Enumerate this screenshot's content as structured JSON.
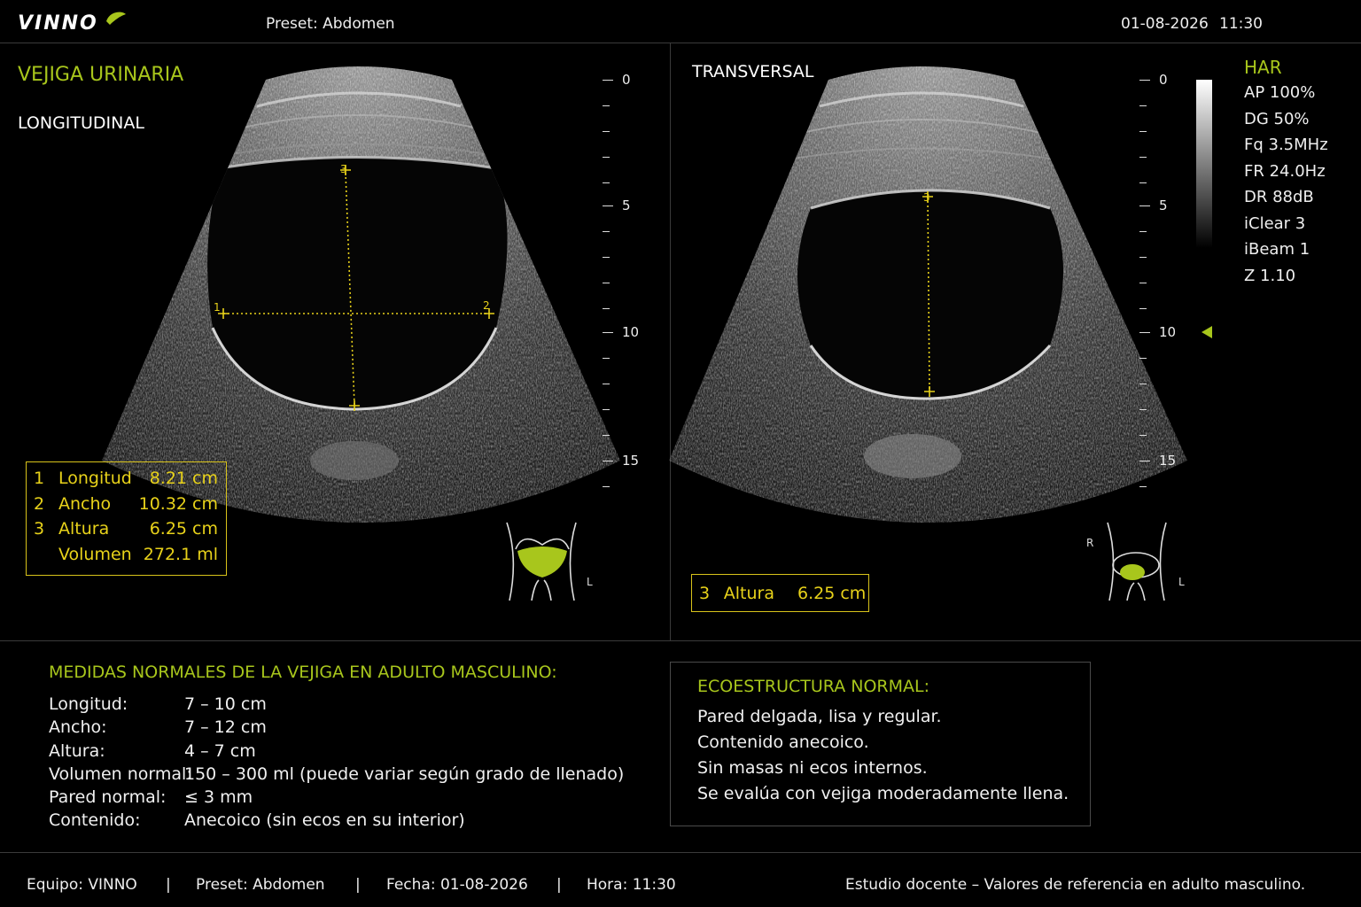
{
  "header": {
    "logo": "VINNO",
    "preset": "Preset: Abdomen",
    "date": "01-08-2026",
    "time": "11:30"
  },
  "left_panel": {
    "title": "VEJIGA URINARIA",
    "subtitle": "LONGITUDINAL",
    "measurements": [
      {
        "num": "1",
        "label": "Longitud",
        "value": "8.21 cm"
      },
      {
        "num": "2",
        "label": "Ancho",
        "value": "10.32 cm"
      },
      {
        "num": "3",
        "label": "Altura",
        "value": "6.25 cm"
      },
      {
        "num": "",
        "label": "Volumen",
        "value": "272.1 ml"
      }
    ],
    "caliper_marks": [
      "1",
      "2",
      "3"
    ],
    "orientation_label": "L"
  },
  "right_panel": {
    "subtitle": "TRANSVERSAL",
    "measurement": {
      "num": "3",
      "label": "Altura",
      "value": "6.25 cm"
    },
    "caliper_mark": "3",
    "orientation_left": "R",
    "orientation_right": "L"
  },
  "depth_scale": {
    "labels": [
      "0",
      "5",
      "10",
      "15"
    ]
  },
  "settings": {
    "mode": "HAR",
    "rows": [
      "AP  100%",
      "DG  50%",
      "Fq  3.5MHz",
      "FR  24.0Hz",
      "DR  88dB",
      "iClear  3",
      "iBeam  1",
      "Z  1.10"
    ]
  },
  "reference": {
    "title": "MEDIDAS NORMALES DE LA VEJIGA EN ADULTO MASCULINO:",
    "rows": [
      {
        "label": "Longitud:",
        "value": "7 – 10 cm"
      },
      {
        "label": "Ancho:",
        "value": "7 – 12 cm"
      },
      {
        "label": "Altura:",
        "value": "4 – 7 cm"
      },
      {
        "label": "Volumen normal:",
        "value": "150 – 300 ml (puede variar según grado de llenado)"
      },
      {
        "label": "Pared normal:",
        "value": "≤ 3 mm"
      },
      {
        "label": "Contenido:",
        "value": "Anecoico (sin ecos en su interior)"
      }
    ]
  },
  "ecostructure": {
    "title": "ECOESTRUCTURA NORMAL:",
    "rows": [
      "Pared delgada, lisa y regular.",
      "Contenido anecoico.",
      "Sin masas ni ecos internos.",
      "Se evalúa con vejiga moderadamente llena."
    ]
  },
  "footer": {
    "equipo": "Equipo: VINNO",
    "preset": "Preset: Abdomen",
    "fecha": "Fecha: 01-08-2026",
    "hora": "Hora: 11:30",
    "separator": "|",
    "note": "Estudio docente – Valores de referencia en adulto masculino."
  },
  "colors": {
    "accent_green": "#a8c61c",
    "caliper_yellow": "#e8d21a",
    "background": "#000000"
  }
}
